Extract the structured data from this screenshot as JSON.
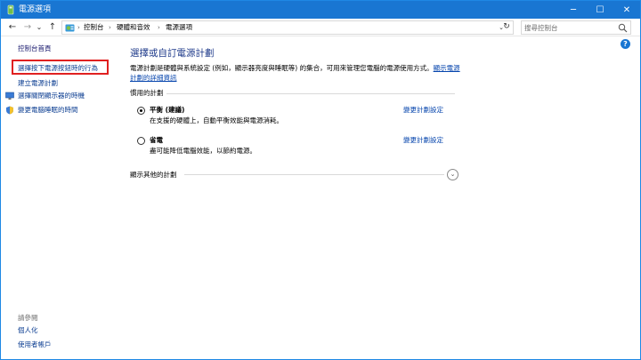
{
  "window": {
    "title": "電源選項",
    "minimize": "─",
    "maximize": "☐",
    "close": "✕"
  },
  "nav": {
    "back": "←",
    "forward": "→",
    "history": "⌄",
    "up": "↑"
  },
  "breadcrumb": {
    "items": [
      "控制台",
      "硬體和音效",
      "電源選項"
    ],
    "separator": "›",
    "dropdown": "⌄",
    "refresh": "↻"
  },
  "search": {
    "placeholder": "搜尋控制台"
  },
  "help": "?",
  "sidebar": {
    "home": "控制台首頁",
    "items": [
      "選擇按下電源按鈕時的行為",
      "建立電源計劃",
      "選擇關閉顯示器的時機",
      "變更電腦睡眠的時間"
    ],
    "see_also_label": "請參閱",
    "see_also": [
      "個人化",
      "使用者帳戶"
    ]
  },
  "main": {
    "title": "選擇或自訂電源計劃",
    "description": "電源計劃是硬體與系統設定 (例如，顯示器亮度與睡眠等) 的集合，可用來管理您電腦的電源使用方式。",
    "description_link": "顯示電源計劃的詳細資訊",
    "section_label": "慣用的計劃",
    "plans": [
      {
        "name": "平衡 (建議)",
        "description": "在支援的硬體上，自動平衡效能與電源消耗。",
        "link": "變更計劃設定",
        "selected": true
      },
      {
        "name": "省電",
        "description": "盡可能降低電腦效能，以節約電源。",
        "link": "變更計劃設定",
        "selected": false
      }
    ],
    "more_plans": "顯示其他的計劃",
    "expand_icon": "⌄"
  },
  "colors": {
    "titlebar": "#1976d2",
    "link": "#0645ad",
    "heading": "#1e3a8a",
    "highlight": "#e02020"
  }
}
